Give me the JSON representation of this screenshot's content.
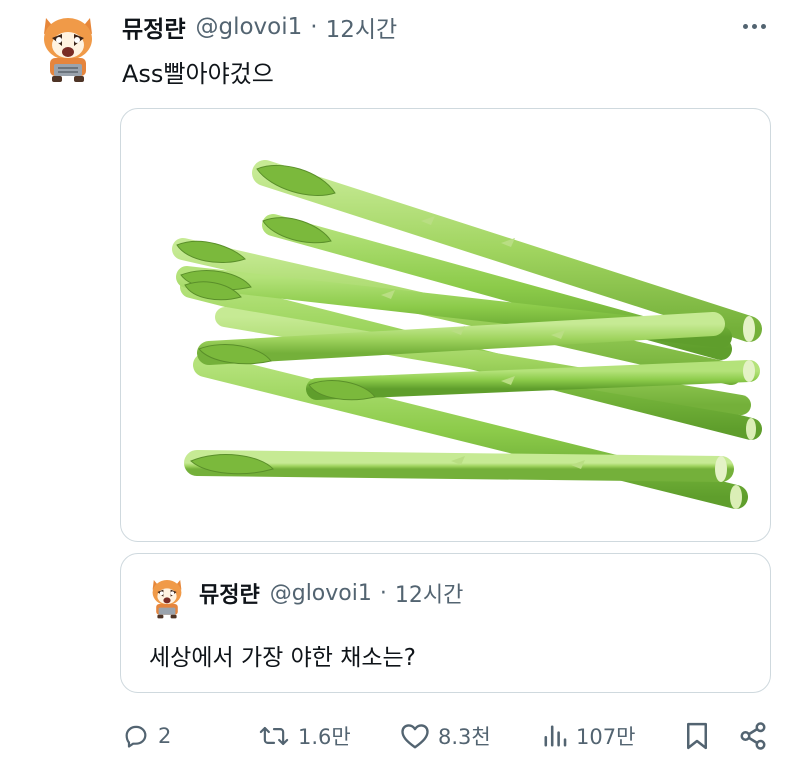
{
  "tweet": {
    "author_name": "뮤정랸",
    "author_handle": "@glovoi1",
    "separator": "·",
    "time": "12시간",
    "text": "Ass빨아야겄으",
    "avatar_icon": "red-panda-avatar-icon",
    "media_icon": "asparagus-photo"
  },
  "quoted_tweet": {
    "author_name": "뮤정랸",
    "author_handle": "@glovoi1",
    "separator": "·",
    "time": "12시간",
    "text": "세상에서 가장 야한 채소는?"
  },
  "actions": {
    "reply": {
      "icon": "reply-icon",
      "count": "2"
    },
    "retweet": {
      "icon": "retweet-icon",
      "count": "1.6만"
    },
    "like": {
      "icon": "heart-icon",
      "count": "8.3천"
    },
    "views": {
      "icon": "views-icon",
      "count": "107만"
    },
    "bookmark": {
      "icon": "bookmark-icon"
    },
    "share": {
      "icon": "share-icon"
    }
  },
  "colors": {
    "text_primary": "#0f1419",
    "text_secondary": "#536471",
    "border": "#cfd9de",
    "asparagus_green": "#8fcf4a"
  }
}
